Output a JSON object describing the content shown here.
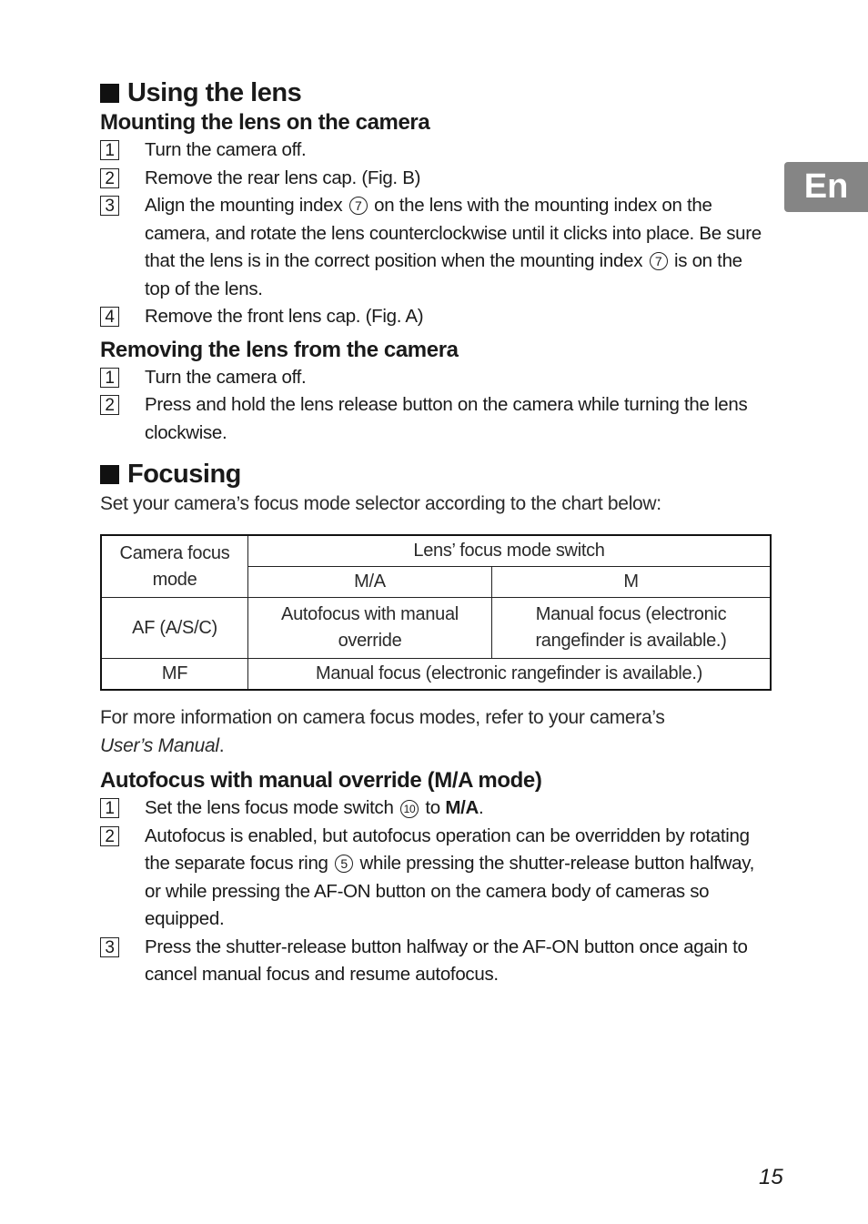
{
  "side_tab": "En",
  "page_number": "15",
  "sections": {
    "using_lens": {
      "title": "Using the lens",
      "mounting": {
        "title": "Mounting the lens on the camera",
        "steps": [
          {
            "n": "1",
            "text": "Turn the camera off."
          },
          {
            "n": "2",
            "text": "Remove the rear lens cap. (Fig. B)"
          },
          {
            "n": "3",
            "text_a": "Align the mounting index",
            "ref_a": "7",
            "text_b": "on the lens with the mounting index on the camera, and rotate the lens counterclockwise until it clicks into place. Be sure that the lens is in the correct position when the mounting index",
            "ref_b": "7",
            "text_c": "is on the top of the lens."
          },
          {
            "n": "4",
            "text": "Remove the front lens cap. (Fig. A)"
          }
        ]
      },
      "removing": {
        "title": "Removing the lens from the camera",
        "steps": [
          {
            "n": "1",
            "text": "Turn the camera off."
          },
          {
            "n": "2",
            "text": "Press and hold the lens release button on the camera while turning the lens clockwise."
          }
        ]
      }
    },
    "focusing": {
      "title": "Focusing",
      "intro": "Set your camera’s focus mode selector according to the chart below:",
      "table": {
        "col_header": "Camera focus mode",
        "group_header": "Lens’ focus mode switch",
        "sub_headers": [
          "M/A",
          "M"
        ],
        "rows": [
          {
            "mode": "AF (A/S/C)",
            "ma": "Autofocus with manual override",
            "m": "Manual focus (electronic rangefinder is available.)"
          },
          {
            "mode": "MF",
            "both": "Manual focus (electronic rangefinder is available.)"
          }
        ]
      },
      "note": "For more information on camera focus modes, refer to your camera’s",
      "note_italic": "User’s Manual",
      "note_end": ".",
      "override": {
        "title": "Autofocus with manual override (M/A mode)",
        "steps": [
          {
            "n": "1",
            "text_a": "Set the lens focus mode switch",
            "ref": "10",
            "text_b": "to",
            "bold": "M/A",
            "text_c": "."
          },
          {
            "n": "2",
            "text_a": "Autofocus is enabled, but autofocus operation can be overridden by rotating the separate focus ring",
            "ref": "5",
            "text_b": "while pressing the shutter-release button halfway, or while pressing the AF-ON button on the camera body of cameras so equipped."
          },
          {
            "n": "3",
            "text": "Press the shutter-release button halfway or the AF-ON button once again to cancel manual focus and resume autofocus."
          }
        ]
      }
    }
  }
}
